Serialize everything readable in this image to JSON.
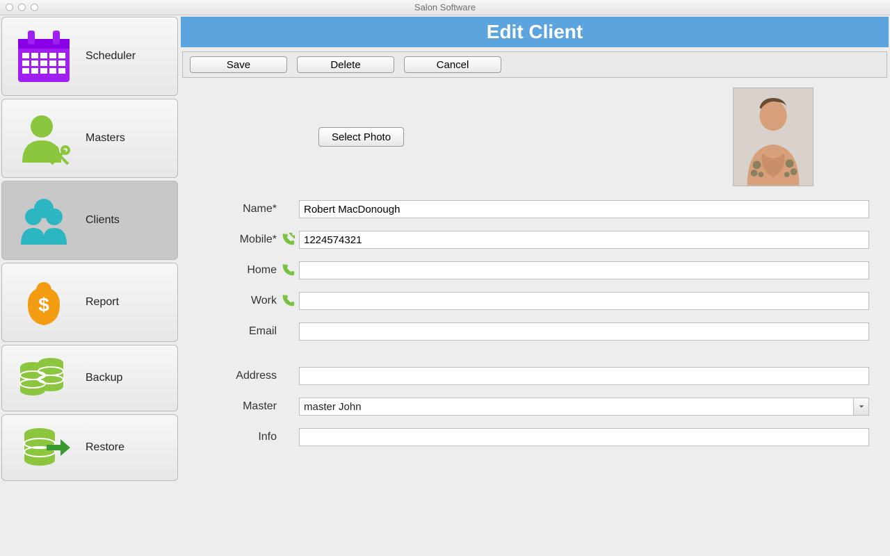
{
  "window_title": "Salon Software",
  "sidebar": {
    "items": [
      {
        "label": "Scheduler"
      },
      {
        "label": "Masters"
      },
      {
        "label": "Clients"
      },
      {
        "label": "Report"
      },
      {
        "label": "Backup"
      },
      {
        "label": "Restore"
      }
    ]
  },
  "header": {
    "title": "Edit Client"
  },
  "toolbar": {
    "save_label": "Save",
    "delete_label": "Delete",
    "cancel_label": "Cancel"
  },
  "photo": {
    "select_label": "Select Photo"
  },
  "form": {
    "name_label": "Name*",
    "name_value": "Robert MacDonough",
    "mobile_label": "Mobile*",
    "mobile_value": "1224574321",
    "home_label": "Home",
    "home_value": "",
    "work_label": "Work",
    "work_value": "",
    "email_label": "Email",
    "email_value": "",
    "address_label": "Address",
    "address_value": "",
    "master_label": "Master",
    "master_value": "master John",
    "info_label": "Info",
    "info_value": ""
  },
  "colors": {
    "accent_header": "#5ca4dd",
    "scheduler_icon": "#a020f0",
    "masters_icon": "#8cc63f",
    "clients_icon": "#2cb6c2",
    "report_icon": "#f39c12",
    "backup_icon": "#8cc63f",
    "phone_icon": "#7ac142"
  }
}
